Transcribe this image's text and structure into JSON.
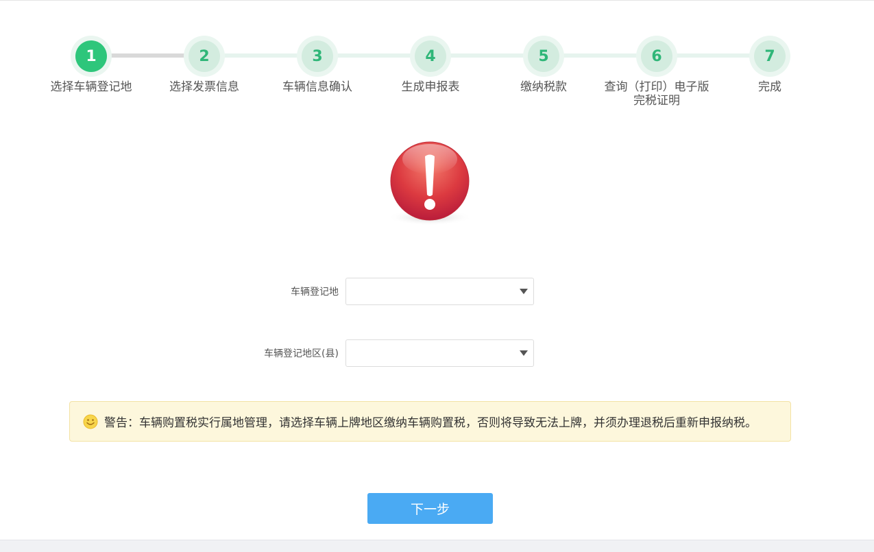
{
  "stepper": {
    "steps": [
      {
        "number": "1",
        "label": "选择车辆登记地"
      },
      {
        "number": "2",
        "label": "选择发票信息"
      },
      {
        "number": "3",
        "label": "车辆信息确认"
      },
      {
        "number": "4",
        "label": "生成申报表"
      },
      {
        "number": "5",
        "label": "缴纳税款"
      },
      {
        "number": "6",
        "label": "查询（打印）电子版完税证明"
      },
      {
        "number": "7",
        "label": "完成"
      }
    ],
    "active_step": "1"
  },
  "form": {
    "region_label": "车辆登记地",
    "region_value": "",
    "county_label": "车辆登记地区(县)",
    "county_value": ""
  },
  "notice": {
    "icon": "smiley-icon",
    "text": "警告：车辆购置税实行属地管理，请选择车辆上牌地区缴纳车辆购置税，否则将导致无法上牌，并须办理退税后重新申报纳税。"
  },
  "actions": {
    "next_label": "下一步"
  },
  "colors": {
    "step_active": "#2ec67b",
    "step_inactive": "#d3ecdf",
    "button": "#4aaaf3",
    "notice_bg": "#fdf7dc",
    "alert_red": "#d9323f"
  }
}
